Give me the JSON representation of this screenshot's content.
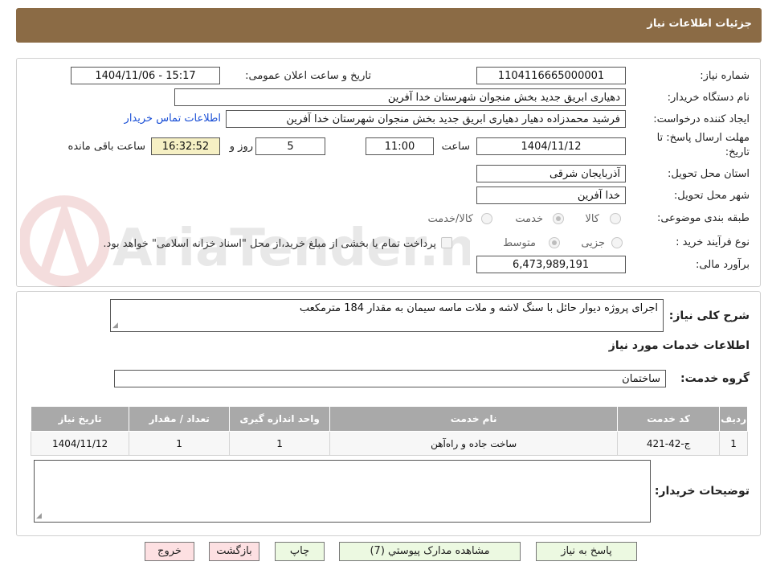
{
  "header": {
    "title": "جزئیات اطلاعات نیاز"
  },
  "fields": {
    "need_number_label": "شماره نیاز:",
    "need_number": "1104116665000001",
    "announce_label": "تاریخ و ساعت اعلان عمومی:",
    "announce_value": "1404/11/06 - 15:17",
    "buyer_org_label": "نام دستگاه خریدار:",
    "buyer_org": "دهیاری ابریق جدید بخش منجوان شهرستان خدا آفرین",
    "requester_label": "ایجاد کننده درخواست:",
    "requester": "فرشید محمدزاده دهیار دهیاری ابریق جدید بخش منجوان شهرستان خدا آفرین",
    "contact_link": "اطلاعات تماس خریدار",
    "deadline_label_1": "مهلت ارسال پاسخ: تا",
    "deadline_label_2": "تاریخ:",
    "deadline_date": "1404/11/12",
    "time_label": "ساعت",
    "deadline_time": "11:00",
    "days_value": "5",
    "days_label": "روز و",
    "remaining_time": "16:32:52",
    "remaining_label": "ساعت باقی مانده",
    "province_label": "استان محل تحویل:",
    "province": "آذربایجان شرقی",
    "city_label": "شهر محل تحویل:",
    "city": "خدا آفرین",
    "category_label": "طبقه بندی موضوعی:",
    "category_options": [
      "کالا",
      "خدمت",
      "کالا/خدمت"
    ],
    "category_selected": 1,
    "process_label": "نوع فرآیند خرید :",
    "process_options": [
      "جزیی",
      "متوسط"
    ],
    "process_selected": 1,
    "payment_note": "پرداخت تمام یا بخشی از مبلغ خرید،از محل \"اسناد خزانه اسلامی\" خواهد بود.",
    "budget_label": "برآورد مالی:",
    "budget": "6,473,989,191"
  },
  "description": {
    "label": "شرح کلی نیاز:",
    "text": "اجرای پروژه دیوار حائل با سنگ لاشه و ملات ماسه سیمان به مقدار 184 مترمکعب"
  },
  "services": {
    "section_title": "اطلاعات خدمات مورد نیاز",
    "group_label": "گروه خدمت:",
    "group_value": "ساختمان",
    "columns": [
      "ردیف",
      "کد خدمت",
      "نام خدمت",
      "واحد اندازه گیری",
      "تعداد / مقدار",
      "تاریخ نیاز"
    ],
    "rows": [
      [
        "1",
        "ج-42-421",
        "ساخت جاده و راه‌آهن",
        "1",
        "1",
        "1404/11/12"
      ]
    ]
  },
  "buyer_notes": {
    "label": "توضیحات خریدار:",
    "text": ""
  },
  "buttons": {
    "reply": "پاسخ به نیاز",
    "attachments": "مشاهده مدارک پیوستي (7)",
    "print": "چاپ",
    "back": "بازگشت",
    "exit": "خروج"
  },
  "watermark": "AriaTender.net",
  "colors": {
    "header_bg": "#8b6b45",
    "table_header_bg": "#a9a9a9",
    "button_green": "#ecf9e1",
    "button_pink": "#fde0e2",
    "link": "#1a4fd6",
    "remaining_bg": "#f6f0c4"
  }
}
